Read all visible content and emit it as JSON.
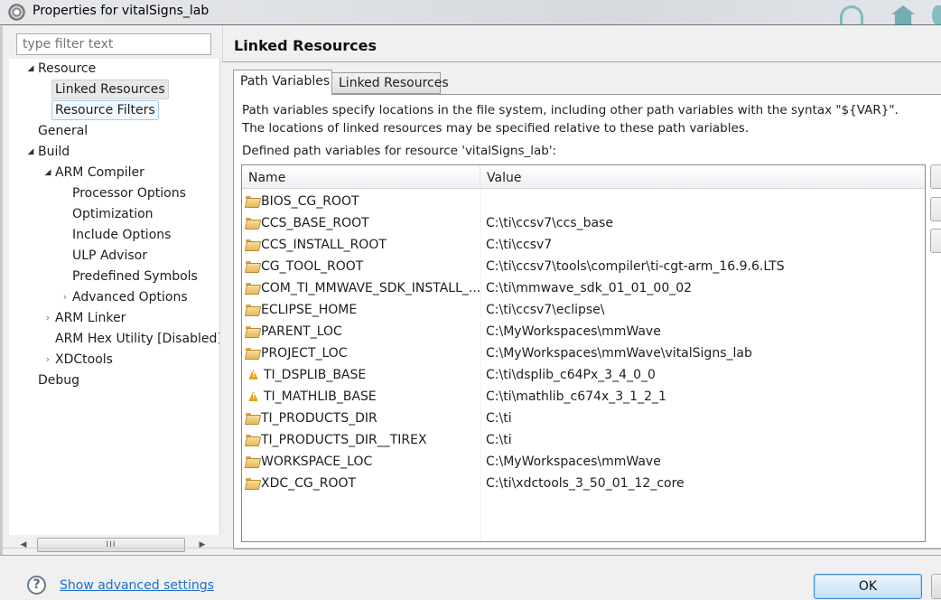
{
  "window": {
    "title": "Properties for vitalSigns_lab",
    "app_icon": "cog-app-icon"
  },
  "filter": {
    "placeholder": "type filter text",
    "value": ""
  },
  "tree": {
    "items": [
      {
        "label": "Resource",
        "level": 0,
        "expander": "expanded"
      },
      {
        "label": "Linked Resources",
        "level": 1,
        "expander": "none",
        "state": "selected"
      },
      {
        "label": "Resource Filters",
        "level": 1,
        "expander": "none",
        "state": "focused"
      },
      {
        "label": "General",
        "level": 0,
        "expander": "none"
      },
      {
        "label": "Build",
        "level": 0,
        "expander": "expanded"
      },
      {
        "label": "ARM Compiler",
        "level": 1,
        "expander": "expanded"
      },
      {
        "label": "Processor Options",
        "level": 2,
        "expander": "none"
      },
      {
        "label": "Optimization",
        "level": 2,
        "expander": "none"
      },
      {
        "label": "Include Options",
        "level": 2,
        "expander": "none"
      },
      {
        "label": "ULP Advisor",
        "level": 2,
        "expander": "none"
      },
      {
        "label": "Predefined Symbols",
        "level": 2,
        "expander": "none"
      },
      {
        "label": "Advanced Options",
        "level": 2,
        "expander": "collapsed"
      },
      {
        "label": "ARM Linker",
        "level": 1,
        "expander": "collapsed"
      },
      {
        "label": "ARM Hex Utility  [Disabled]",
        "level": 1,
        "expander": "none"
      },
      {
        "label": "XDCtools",
        "level": 1,
        "expander": "collapsed"
      },
      {
        "label": "Debug",
        "level": 0,
        "expander": "none"
      }
    ],
    "expander_glyphs": {
      "expanded": "◢",
      "collapsed": "›"
    },
    "scrollbar": {
      "left_arrow": "◀",
      "right_arrow": "▶",
      "grip": "III"
    }
  },
  "page": {
    "title": "Linked Resources",
    "tabs": [
      {
        "label": "Path Variables",
        "active": true
      },
      {
        "label": "Linked Resources",
        "active": false
      }
    ],
    "description_line1": "Path variables specify locations in the file system, including other path variables with the syntax \"${VAR}\".",
    "description_line2": "The locations of linked resources may be specified relative to these path variables.",
    "defined_label": "Defined path variables for resource 'vitalSigns_lab':",
    "table": {
      "columns": [
        "Name",
        "Value"
      ],
      "rows": [
        {
          "icon": "folder",
          "name": "BIOS_CG_ROOT",
          "value": ""
        },
        {
          "icon": "folder",
          "name": "CCS_BASE_ROOT",
          "value": "C:\\ti\\ccsv7\\ccs_base"
        },
        {
          "icon": "folder",
          "name": "CCS_INSTALL_ROOT",
          "value": "C:\\ti\\ccsv7"
        },
        {
          "icon": "folder",
          "name": "CG_TOOL_ROOT",
          "value": "C:\\ti\\ccsv7\\tools\\compiler\\ti-cgt-arm_16.9.6.LTS"
        },
        {
          "icon": "folder",
          "name": "COM_TI_MMWAVE_SDK_INSTALL_...",
          "value": "C:\\ti\\mmwave_sdk_01_01_00_02"
        },
        {
          "icon": "folder",
          "name": "ECLIPSE_HOME",
          "value": "C:\\ti\\ccsv7\\eclipse\\"
        },
        {
          "icon": "folder",
          "name": "PARENT_LOC",
          "value": "C:\\MyWorkspaces\\mmWave"
        },
        {
          "icon": "folder",
          "name": "PROJECT_LOC",
          "value": "C:\\MyWorkspaces\\mmWave\\vitalSigns_lab"
        },
        {
          "icon": "warning",
          "name": "TI_DSPLIB_BASE",
          "value": "C:\\ti\\dsplib_c64Px_3_4_0_0"
        },
        {
          "icon": "warning",
          "name": "TI_MATHLIB_BASE",
          "value": "C:\\ti\\mathlib_c674x_3_1_2_1"
        },
        {
          "icon": "folder",
          "name": "TI_PRODUCTS_DIR",
          "value": "C:\\ti"
        },
        {
          "icon": "folder",
          "name": "TI_PRODUCTS_DIR__TIREX",
          "value": "C:\\ti"
        },
        {
          "icon": "folder",
          "name": "WORKSPACE_LOC",
          "value": "C:\\MyWorkspaces\\mmWave"
        },
        {
          "icon": "folder",
          "name": "XDC_CG_ROOT",
          "value": "C:\\ti\\xdctools_3_50_01_12_core"
        }
      ]
    }
  },
  "footer": {
    "help_glyph": "?",
    "advanced_link": "Show advanced settings",
    "ok_label": "OK"
  }
}
